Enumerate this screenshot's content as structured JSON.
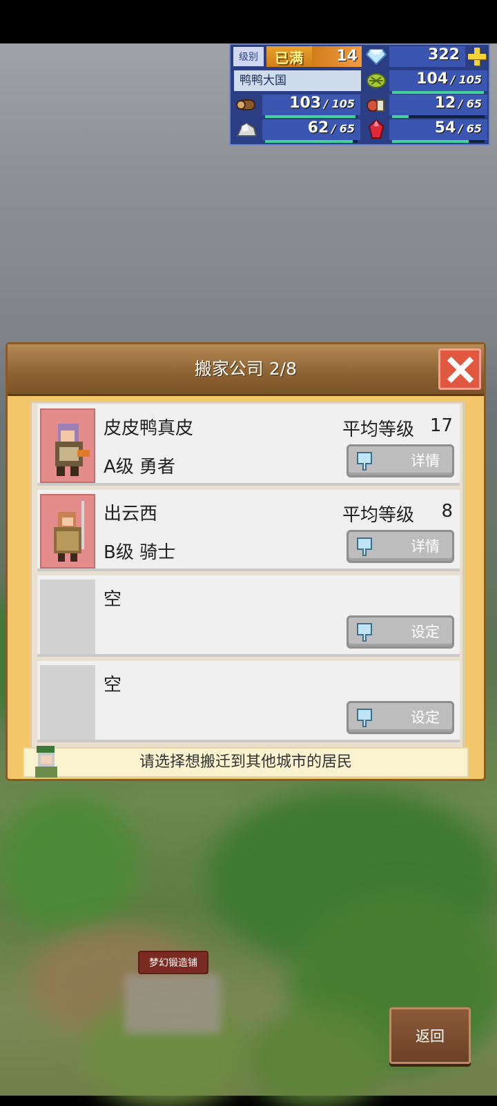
{
  "hud": {
    "level_label": "级别",
    "level_badge": "已满",
    "level_value": "14",
    "gems": "322",
    "kingdom_name": "鸭鸭大国",
    "resources": [
      {
        "name": "wood",
        "value": "103",
        "max": "105",
        "fill": 0.98
      },
      {
        "name": "grain",
        "value": "104",
        "max": "105",
        "fill": 0.99
      },
      {
        "name": "food",
        "value": "12",
        "max": "65",
        "fill": 0.18
      },
      {
        "name": "ore",
        "value": "62",
        "max": "65",
        "fill": 0.95
      },
      {
        "name": "mana",
        "value": "54",
        "max": "65",
        "fill": 0.83
      }
    ]
  },
  "dialog": {
    "title": "搬家公司 2/8",
    "hint": "请选择想搬迁到其他城市的居民",
    "entries": [
      {
        "name": "皮皮鸭真皮",
        "rank": "A级 勇者",
        "avg_label": "平均等级",
        "avg_value": "17",
        "button": "详情"
      },
      {
        "name": "出云西",
        "rank": "B级 骑士",
        "avg_label": "平均等级",
        "avg_value": "8",
        "button": "详情"
      },
      {
        "name": "空",
        "button": "设定"
      },
      {
        "name": "空",
        "button": "设定"
      }
    ]
  },
  "scene": {
    "shop_sign": "梦幻锻造铺"
  },
  "back_button": "返回",
  "colors": {
    "hud_bg": "#2c3e83",
    "dialog_bg": "#f3c669",
    "close_red": "#e0583f",
    "portrait_red": "#e48b8b"
  }
}
